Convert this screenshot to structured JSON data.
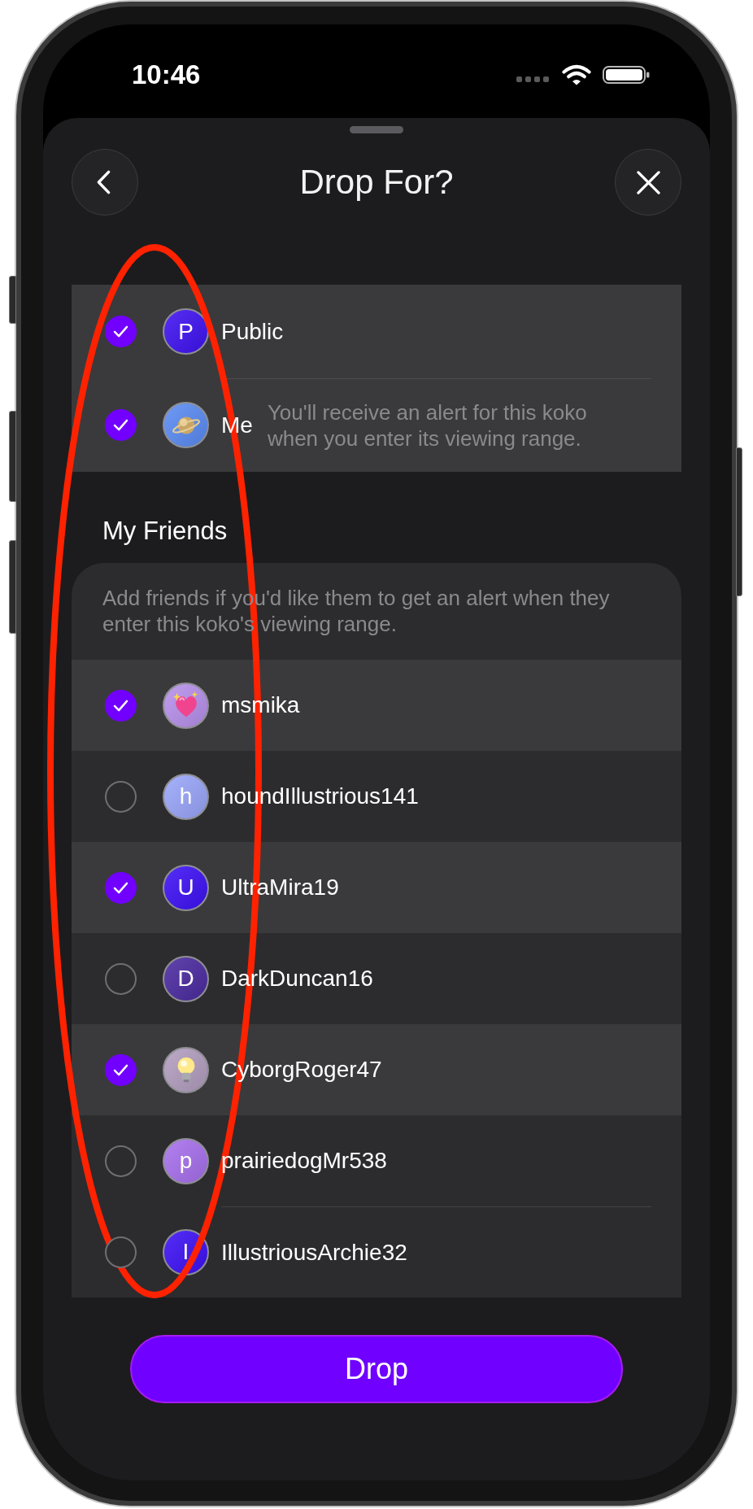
{
  "status_bar": {
    "time": "10:46"
  },
  "sheet": {
    "title": "Drop For?"
  },
  "audience": [
    {
      "name": "Public",
      "checked": true,
      "avatar": {
        "kind": "letter",
        "letter": "P",
        "color": "#3f12f2"
      }
    },
    {
      "name": "Me",
      "checked": true,
      "avatar": {
        "kind": "planet",
        "color": "#5a8cf5"
      },
      "note": "You'll receive an alert for this koko when you enter its viewing range."
    }
  ],
  "friends": {
    "heading": "My Friends",
    "hint": "Add friends if you'd like them to get an alert when they enter this koko's viewing range.",
    "rows": [
      {
        "name": "msmika",
        "checked": true,
        "avatar": {
          "kind": "sparkling-heart",
          "color": "#b890ec"
        }
      },
      {
        "name": "houndIllustrious141",
        "checked": false,
        "avatar": {
          "kind": "letter",
          "letter": "h",
          "color": "#9aa6fb"
        }
      },
      {
        "name": "UltraMira19",
        "checked": true,
        "avatar": {
          "kind": "letter",
          "letter": "U",
          "color": "#3d10f6"
        }
      },
      {
        "name": "DarkDuncan16",
        "checked": false,
        "avatar": {
          "kind": "letter",
          "letter": "D",
          "color": "#4b2aa0"
        }
      },
      {
        "name": "CyborgRoger47",
        "checked": true,
        "avatar": {
          "kind": "lightbulb",
          "color": "#b39ec0"
        }
      },
      {
        "name": "prairiedogMr538",
        "checked": false,
        "avatar": {
          "kind": "letter",
          "letter": "p",
          "color": "#a870ee"
        }
      },
      {
        "name": "IllustriousArchie32",
        "checked": false,
        "avatar": {
          "kind": "letter",
          "letter": "I",
          "color": "#3d10f6"
        }
      }
    ]
  },
  "action_button": {
    "label": "Drop"
  }
}
